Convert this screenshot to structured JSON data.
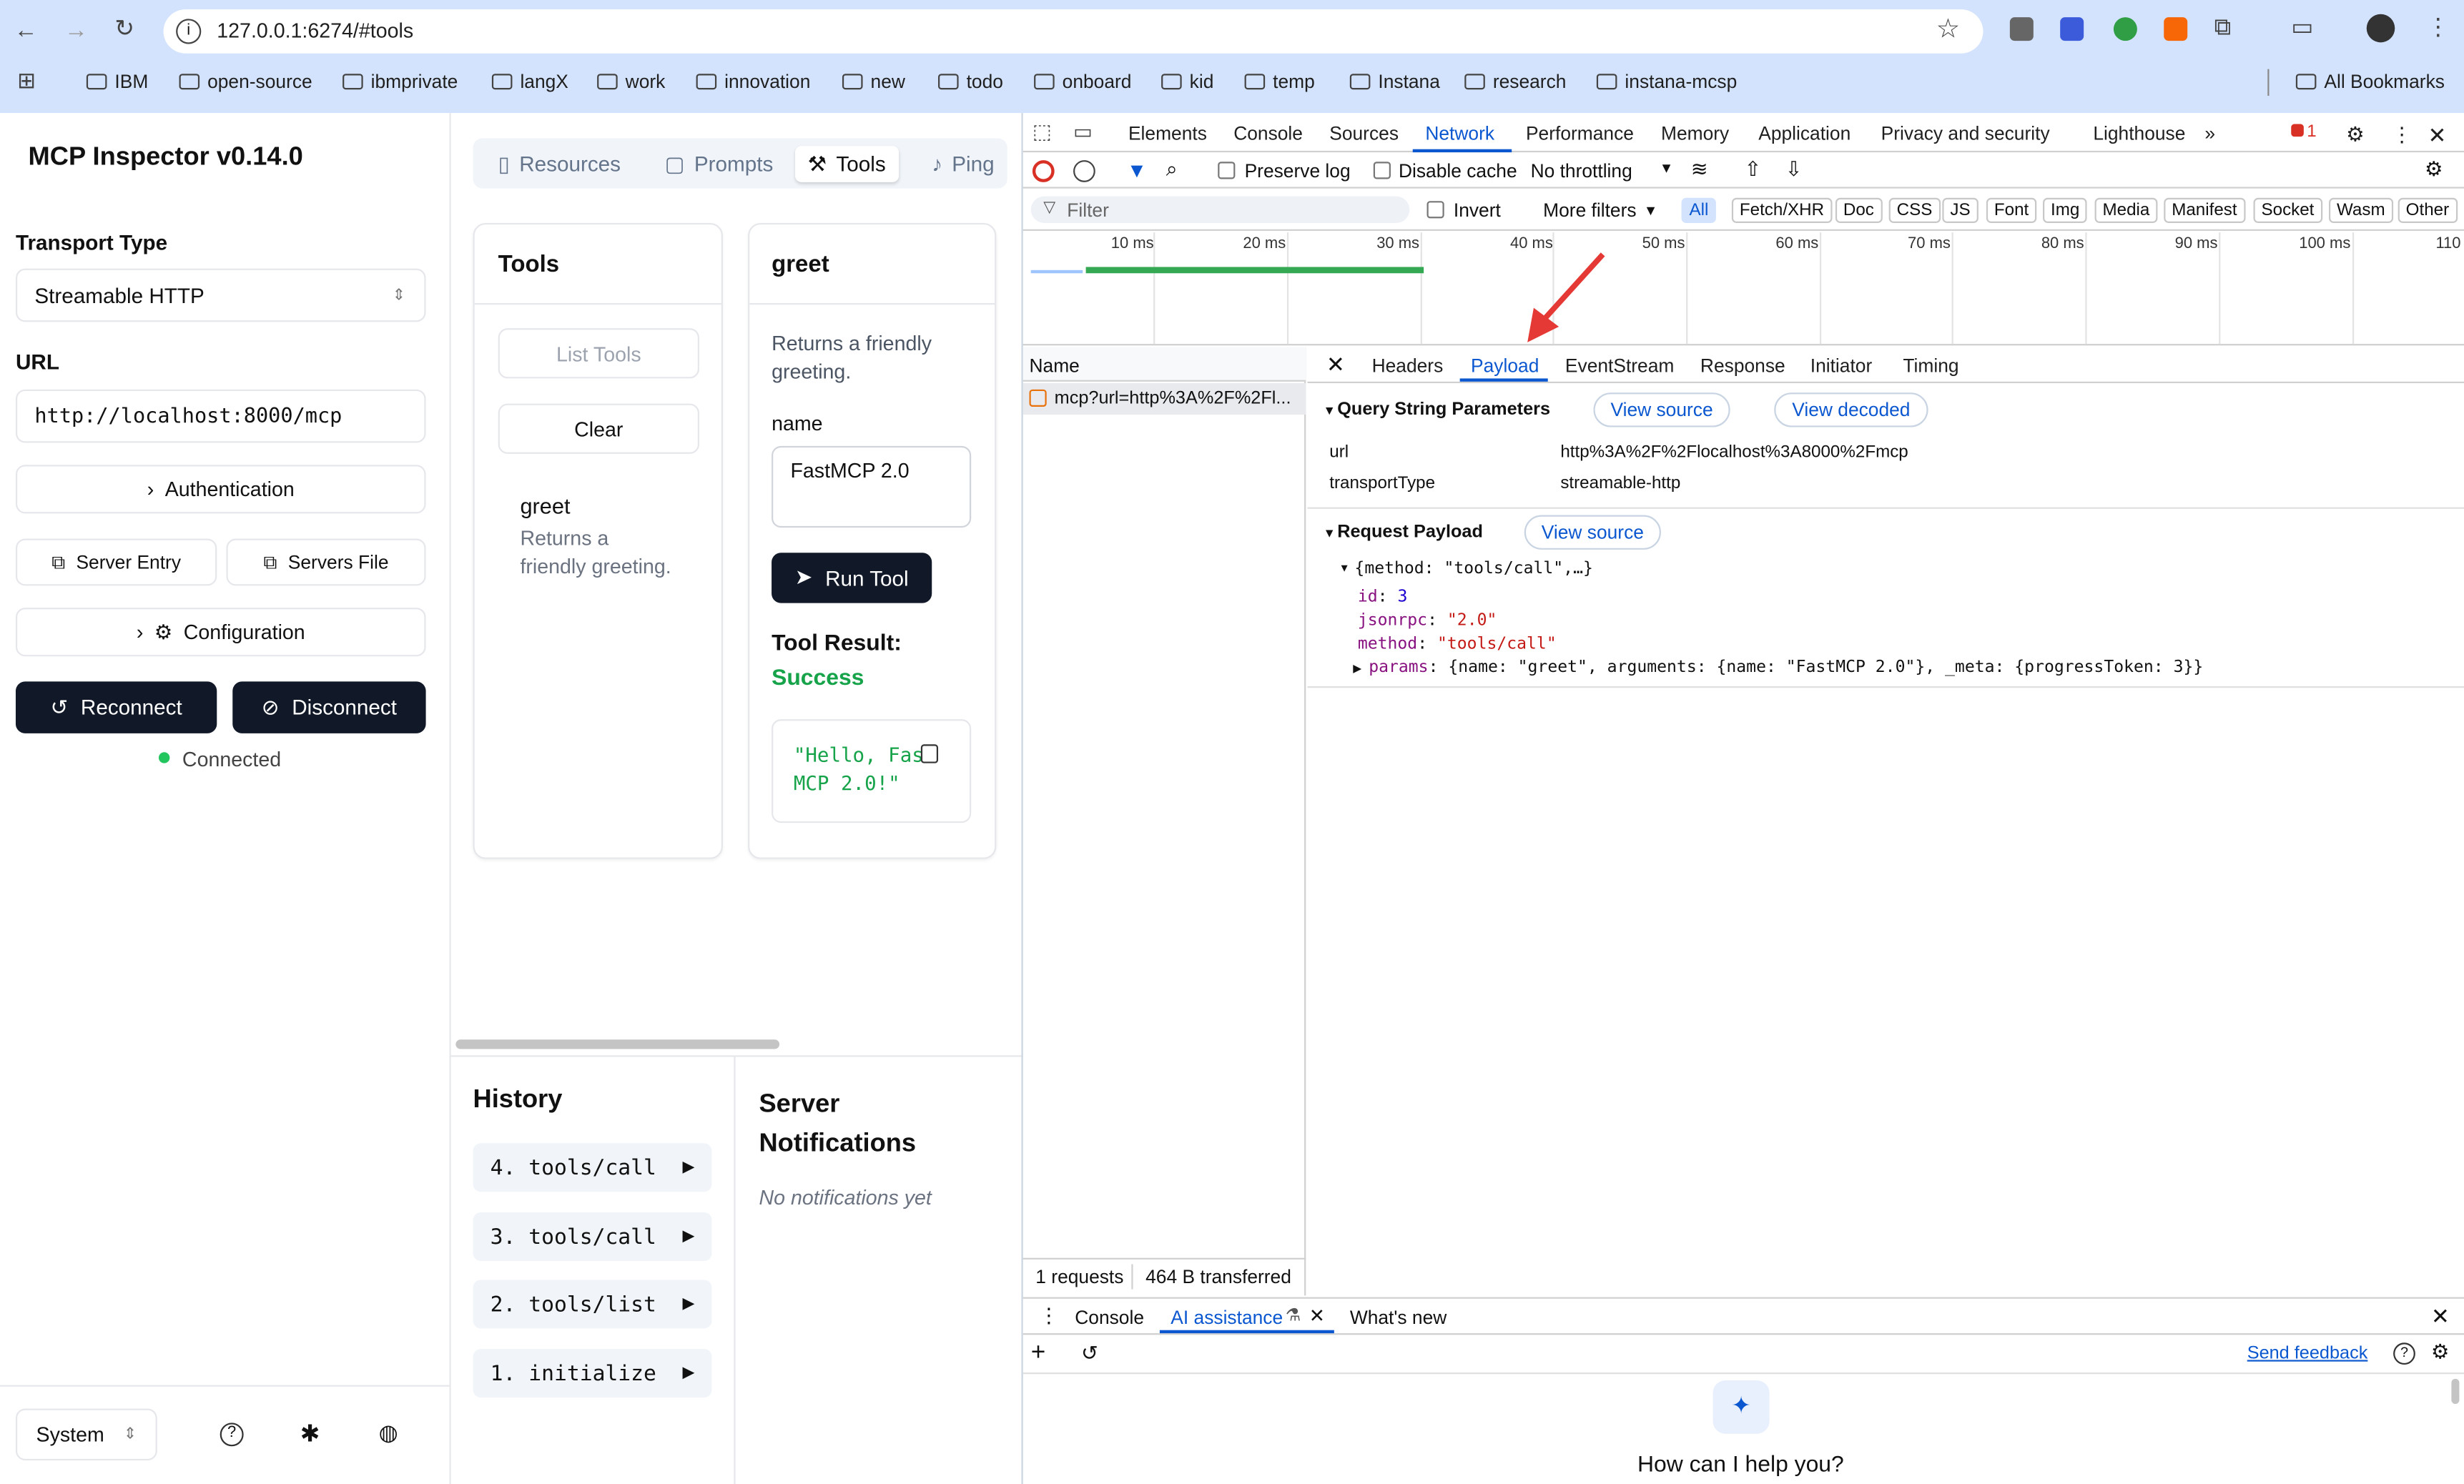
{
  "browser": {
    "url": "127.0.0.1:6274/#tools",
    "bookmarks": [
      "IBM",
      "open-source",
      "ibmprivate",
      "langX",
      "work",
      "innovation",
      "new",
      "todo",
      "onboard",
      "kid",
      "temp",
      "Instana",
      "research",
      "instana-mcsp"
    ],
    "all_bookmarks": "All Bookmarks"
  },
  "inspector": {
    "title": "MCP Inspector v0.14.0",
    "transport_label": "Transport Type",
    "transport_value": "Streamable HTTP",
    "url_label": "URL",
    "url_value": "http://localhost:8000/mcp",
    "authentication": "Authentication",
    "server_entry": "Server Entry",
    "servers_file": "Servers File",
    "configuration": "Configuration",
    "reconnect": "Reconnect",
    "disconnect": "Disconnect",
    "status": "Connected",
    "theme": "System"
  },
  "tabs": [
    "Resources",
    "Prompts",
    "Tools",
    "Ping"
  ],
  "tools_panel": {
    "title": "Tools",
    "list_tools": "List Tools",
    "clear": "Clear",
    "tool_name": "greet",
    "tool_desc": "Returns a friendly greeting."
  },
  "greet_panel": {
    "title": "greet",
    "desc": "Returns a friendly greeting.",
    "param_label": "name",
    "param_value": "FastMCP 2.0",
    "run": "Run Tool",
    "result_label": "Tool Result:",
    "result_status": "Success",
    "result_line1": "\"Hello, Fas",
    "result_line2": "MCP 2.0!\""
  },
  "history": {
    "title": "History",
    "items": [
      "4. tools/call",
      "3. tools/call",
      "2. tools/list",
      "1. initialize"
    ]
  },
  "notifications": {
    "title": "Server Notifications",
    "empty": "No notifications yet"
  },
  "devtools": {
    "tabs": [
      "Elements",
      "Console",
      "Sources",
      "Network",
      "Performance",
      "Memory",
      "Application",
      "Privacy and security",
      "Lighthouse"
    ],
    "errors": "1",
    "preserve_log": "Preserve log",
    "disable_cache": "Disable cache",
    "throttling": "No throttling",
    "filter_placeholder": "Filter",
    "invert": "Invert",
    "more_filters": "More filters",
    "filter_chips": [
      "All",
      "Fetch/XHR",
      "Doc",
      "CSS",
      "JS",
      "Font",
      "Img",
      "Media",
      "Manifest",
      "Socket",
      "Wasm",
      "Other"
    ],
    "timeline_ticks": [
      "10 ms",
      "20 ms",
      "30 ms",
      "40 ms",
      "50 ms",
      "60 ms",
      "70 ms",
      "80 ms",
      "90 ms",
      "100 ms",
      "110"
    ],
    "name_header": "Name",
    "request_name": "mcp?url=http%3A%2F%2Fl...",
    "detail_tabs": [
      "Headers",
      "Payload",
      "EventStream",
      "Response",
      "Initiator",
      "Timing"
    ],
    "qsp_title": "Query String Parameters",
    "view_source": "View source",
    "view_decoded": "View decoded",
    "qsp": [
      {
        "k": "url",
        "v": "http%3A%2F%2Flocalhost%3A8000%2Fmcp"
      },
      {
        "k": "transportType",
        "v": "streamable-http"
      }
    ],
    "rp_title": "Request Payload",
    "payload_summary": "{method: \"tools/call\",…}",
    "id_key": "id",
    "id_val": "3",
    "jsonrpc_key": "jsonrpc",
    "jsonrpc_val": "\"2.0\"",
    "method_key": "method",
    "method_val": "\"tools/call\"",
    "params_key": "params",
    "params_val": "{name: \"greet\", arguments: {name: \"FastMCP 2.0\"}, _meta: {progressToken: 3}}",
    "requests": "1 requests",
    "transferred": "464 B transferred",
    "drawer_tabs": [
      "Console",
      "AI assistance",
      "What's new"
    ],
    "send_feedback": "Send feedback",
    "ai_prompt": "How can I help you?"
  },
  "colors": {
    "chrome_bg": "#d3e3fd",
    "dark_button": "#111827",
    "success": "#16a34a",
    "link_blue": "#0b57d0",
    "arrow": "#e53935"
  }
}
